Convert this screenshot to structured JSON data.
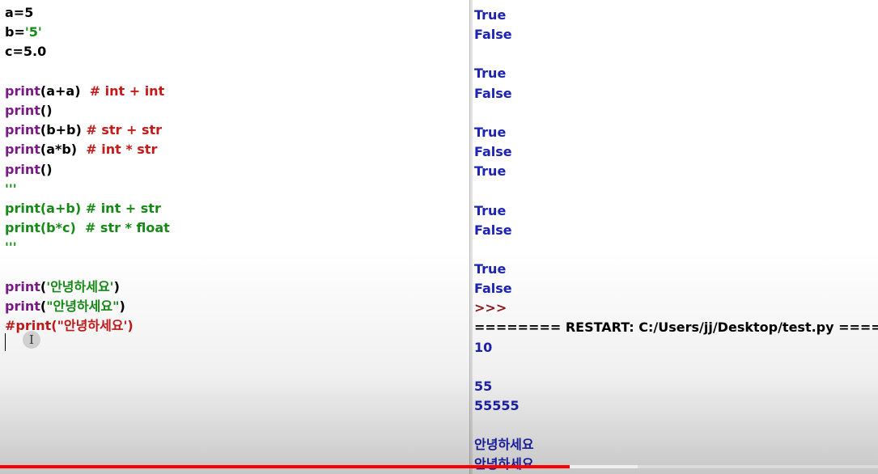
{
  "editor": {
    "lines": [
      [
        {
          "t": "a=5",
          "c": "tx"
        }
      ],
      [
        {
          "t": "b=",
          "c": "tx"
        },
        {
          "t": "'5'",
          "c": "str"
        }
      ],
      [
        {
          "t": "c=5.0",
          "c": "tx"
        }
      ],
      [],
      [
        {
          "t": "print",
          "c": "fn"
        },
        {
          "t": "(a+a)  ",
          "c": "tx"
        },
        {
          "t": "# int + int",
          "c": "cm"
        }
      ],
      [
        {
          "t": "print",
          "c": "fn"
        },
        {
          "t": "()",
          "c": "tx"
        }
      ],
      [
        {
          "t": "print",
          "c": "fn"
        },
        {
          "t": "(b+b) ",
          "c": "tx"
        },
        {
          "t": "# str + str",
          "c": "cm"
        }
      ],
      [
        {
          "t": "print",
          "c": "fn"
        },
        {
          "t": "(a*b)  ",
          "c": "tx"
        },
        {
          "t": "# int * str",
          "c": "cm"
        }
      ],
      [
        {
          "t": "print",
          "c": "fn"
        },
        {
          "t": "()",
          "c": "tx"
        }
      ],
      [
        {
          "t": "'''",
          "c": "doc"
        }
      ],
      [
        {
          "t": "print(a+b) # int + str",
          "c": "doc"
        }
      ],
      [
        {
          "t": "print(b*c)  # str * float",
          "c": "doc"
        }
      ],
      [
        {
          "t": "'''",
          "c": "doc"
        }
      ],
      [],
      [
        {
          "t": "print",
          "c": "fn"
        },
        {
          "t": "(",
          "c": "tx"
        },
        {
          "t": "'안녕하세요'",
          "c": "str"
        },
        {
          "t": ")",
          "c": "tx"
        }
      ],
      [
        {
          "t": "print",
          "c": "fn"
        },
        {
          "t": "(",
          "c": "tx"
        },
        {
          "t": "\"안녕하세요\"",
          "c": "str"
        },
        {
          "t": ")",
          "c": "tx"
        }
      ],
      [
        {
          "t": "#print(\"안녕하세요')",
          "c": "cm"
        }
      ]
    ]
  },
  "shell": {
    "lines": [
      {
        "t": "True",
        "c": "out"
      },
      {
        "t": "False",
        "c": "out"
      },
      {
        "t": "",
        "c": "out"
      },
      {
        "t": "True",
        "c": "out"
      },
      {
        "t": "False",
        "c": "out"
      },
      {
        "t": "",
        "c": "out"
      },
      {
        "t": "True",
        "c": "out"
      },
      {
        "t": "False",
        "c": "out"
      },
      {
        "t": "True",
        "c": "out"
      },
      {
        "t": "",
        "c": "out"
      },
      {
        "t": "True",
        "c": "out"
      },
      {
        "t": "False",
        "c": "out"
      },
      {
        "t": "",
        "c": "out"
      },
      {
        "t": "True",
        "c": "out"
      },
      {
        "t": "False",
        "c": "out"
      },
      {
        "t": ">>>",
        "c": "prompt"
      },
      {
        "t": "======== RESTART: C:/Users/jj/Desktop/test.py ========",
        "c": "restart"
      },
      {
        "t": "10",
        "c": "out"
      },
      {
        "t": "",
        "c": "out"
      },
      {
        "t": "55",
        "c": "out"
      },
      {
        "t": "55555",
        "c": "out"
      },
      {
        "t": "",
        "c": "out"
      },
      {
        "t": "안녕하세요",
        "c": "out"
      },
      {
        "t": "안녕하세요",
        "c": "out"
      }
    ]
  },
  "text_cursor_icon": "I",
  "video_progress": {
    "played_fraction": 0.649,
    "buffered_fraction": 0.726
  }
}
